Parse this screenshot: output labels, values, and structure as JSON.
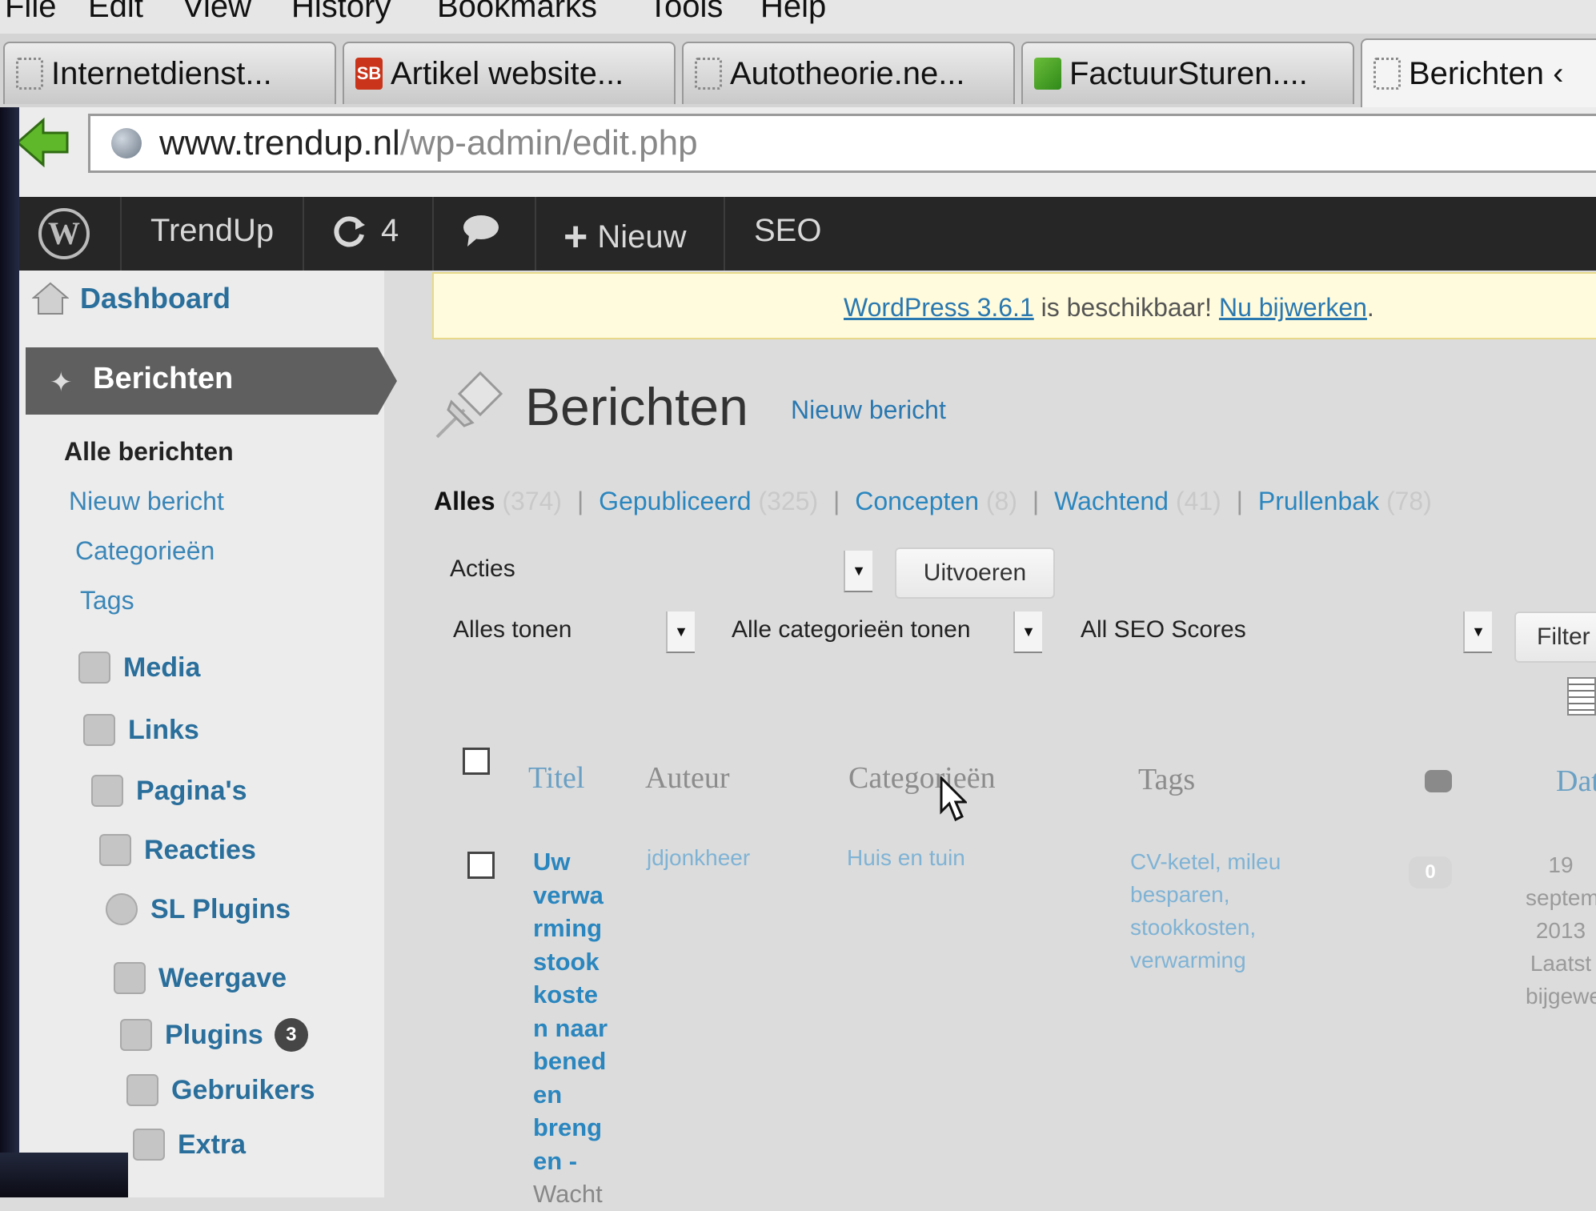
{
  "browser": {
    "menu": [
      "File",
      "Edit",
      "View",
      "History",
      "Bookmarks",
      "Tools",
      "Help"
    ],
    "tabs": [
      {
        "label": "Internetdienst..."
      },
      {
        "label": "Artikel website..."
      },
      {
        "label": "Autotheorie.ne..."
      },
      {
        "label": "FactuurSturen...."
      },
      {
        "label": "Berichten ‹"
      }
    ],
    "url_domain": "www.trendup.nl",
    "url_path": "/wp-admin/edit.php"
  },
  "adminbar": {
    "logo": "W",
    "site": "TrendUp",
    "updates_icon": "refresh-icon",
    "updates_count": "4",
    "new_label": "Nieuw",
    "seo_label": "SEO"
  },
  "sidebar": {
    "dashboard": "Dashboard",
    "active": "Berichten",
    "submenu": [
      "Alle berichten",
      "Nieuw bericht",
      "Categorieën",
      "Tags"
    ],
    "items": [
      {
        "label": "Media",
        "icon": "media-icon"
      },
      {
        "label": "Links",
        "icon": "links-icon"
      },
      {
        "label": "Pagina's",
        "icon": "pages-icon"
      },
      {
        "label": "Reacties",
        "icon": "comments-icon"
      },
      {
        "label": "SL Plugins",
        "icon": "gear-icon"
      },
      {
        "label": "Weergave",
        "icon": "appearance-icon"
      },
      {
        "label": "Plugins",
        "icon": "plugins-icon",
        "badge": "3"
      },
      {
        "label": "Gebruikers",
        "icon": "users-icon"
      },
      {
        "label": "Extra",
        "icon": "tools-icon"
      }
    ]
  },
  "notice": {
    "version_link": "WordPress 3.6.1",
    "text": " is beschikbaar! ",
    "update_link": "Nu bijwerken",
    "end": "."
  },
  "page": {
    "title": "Berichten",
    "new_post": "Nieuw bericht"
  },
  "filters": {
    "views": [
      {
        "label": "Alles",
        "count": "(374)"
      },
      {
        "label": "Gepubliceerd",
        "count": "(325)"
      },
      {
        "label": "Concepten",
        "count": "(8)"
      },
      {
        "label": "Wachtend",
        "count": "(41)"
      },
      {
        "label": "Prullenbak",
        "count": "(78)"
      }
    ],
    "bulk_actions": "Acties",
    "apply": "Uitvoeren",
    "dates": "Alles tonen",
    "categories": "Alle categorieën tonen",
    "seo": "All SEO Scores",
    "filter_btn": "Filter"
  },
  "table": {
    "headers": {
      "title": "Titel",
      "author": "Auteur",
      "categories": "Categorieën",
      "tags": "Tags",
      "date": "Datum"
    },
    "row": {
      "title_lines": [
        "Uw",
        "verwa",
        "rming",
        "stook",
        "koste",
        "n naar",
        "bened",
        "en",
        "breng",
        "en -",
        "Wacht"
      ],
      "author": "jdjonkheer",
      "category": "Huis en tuin",
      "tag_lines": [
        "CV-ketel, mileu",
        "besparen,",
        "stookkosten,",
        "verwarming"
      ],
      "comments": "0",
      "date_lines": [
        "19",
        "september",
        "2013",
        "Laatst",
        "bijgewerkt"
      ]
    }
  }
}
